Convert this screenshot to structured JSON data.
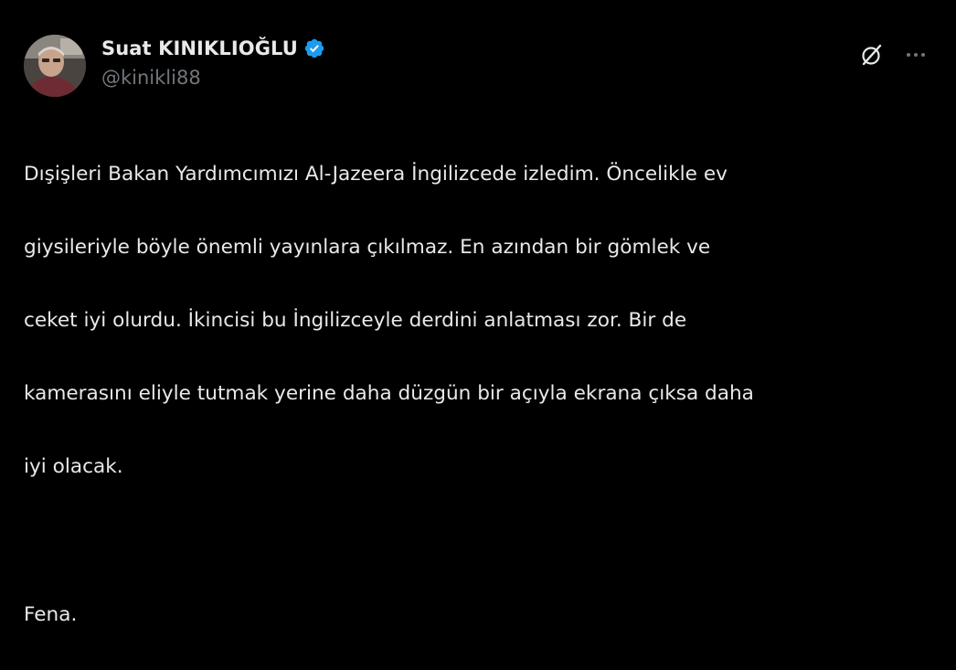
{
  "tweet": {
    "author": {
      "display_name": "Suat KINIKLIOĞLU",
      "handle": "@kinikli88",
      "verified": true,
      "avatar_icon": "profile-photo"
    },
    "actions": {
      "grok_icon": "grok-icon",
      "more_icon": "more-horizontal-icon"
    },
    "body_lines": [
      "Dışişleri Bakan Yardımcımızı Al-Jazeera İngilizcede izledim. Öncelikle ev",
      "giysileriyle böyle önemli yayınlara çıkılmaz. En azından bir gömlek ve",
      "ceket iyi olurdu. İkincisi bu İngilizceyle derdini anlatması zor.  Bir de",
      "kamerasını eliyle tutmak yerine daha düzgün bir açıyla ekrana çıksa daha",
      "iyi olacak.",
      "",
      "Fena."
    ]
  },
  "colors": {
    "background": "#000000",
    "text_primary": "#e7e9ea",
    "text_secondary": "#71767b",
    "verified_blue": "#1d9bf0"
  }
}
